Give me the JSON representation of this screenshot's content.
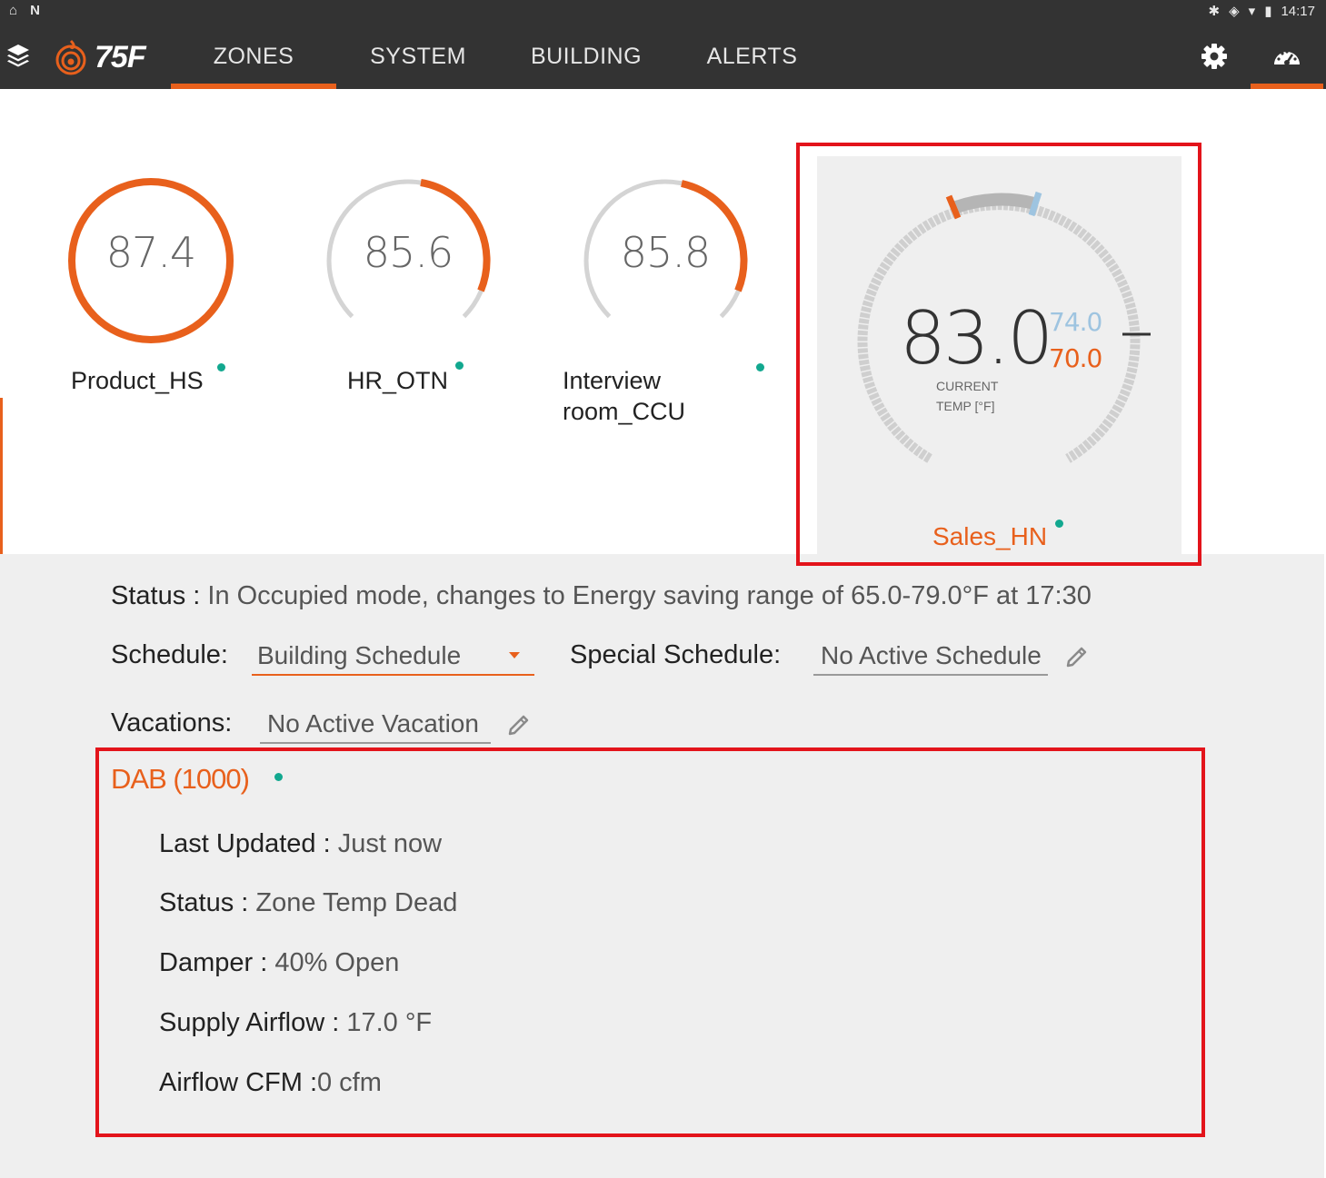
{
  "status_bar": {
    "time": "14:17"
  },
  "app": {
    "logo_text": "75F"
  },
  "tabs": [
    {
      "label": "ZONES",
      "active": true
    },
    {
      "label": "SYSTEM",
      "active": false
    },
    {
      "label": "BUILDING",
      "active": false
    },
    {
      "label": "ALERTS",
      "active": false
    }
  ],
  "zones": [
    {
      "name": "Product_HS",
      "temp": "87.4"
    },
    {
      "name": "HR_OTN",
      "temp": "85.6"
    },
    {
      "name": "Interview room_CCU",
      "temp": "85.8"
    }
  ],
  "selected_zone": {
    "name": "Sales_HN",
    "current_temp": "83.0",
    "cooling_setpoint": "74.0",
    "heating_setpoint": "70.0",
    "current_label": "CURRENT",
    "temp_label": "TEMP [°F]"
  },
  "details": {
    "status_label": "Status :",
    "status_value": " In Occupied mode, changes to Energy saving range of 65.0-79.0°F at 17:30",
    "schedule_label": "Schedule:",
    "schedule_value": "Building Schedule",
    "special_schedule_label": "Special Schedule:",
    "special_schedule_value": "No Active Schedule",
    "vacations_label": "Vacations:",
    "vacations_value": "No Active Vacation"
  },
  "equipment": {
    "title": "DAB (1000)",
    "last_updated_label": "Last Updated : ",
    "last_updated_value": "Just now",
    "status_label": "Status : ",
    "status_value": "Zone Temp Dead",
    "damper_label": "Damper : ",
    "damper_value": "40% Open",
    "supply_airflow_label": "Supply Airflow : ",
    "supply_airflow_value": "17.0 °F",
    "airflow_cfm_label": "Airflow CFM :",
    "airflow_cfm_value": "0 cfm"
  },
  "colors": {
    "accent": "#e8601c",
    "status_dot": "#12a88f",
    "appbar": "#333333",
    "highlight": "#e3141b",
    "cooling": "#9ec4e0"
  }
}
